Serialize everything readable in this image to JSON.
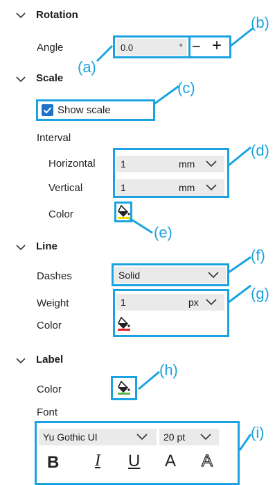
{
  "rotation": {
    "title": "Rotation",
    "angle_label": "Angle",
    "angle_value": "0.0",
    "angle_unit": "°",
    "minus": "−",
    "plus": "+"
  },
  "scale": {
    "title": "Scale",
    "show_scale_label": "Show scale",
    "show_scale_checked": true,
    "interval_label": "Interval",
    "horizontal_label": "Horizontal",
    "horizontal_value": "1",
    "horizontal_unit": "mm",
    "vertical_label": "Vertical",
    "vertical_value": "1",
    "vertical_unit": "mm",
    "color_label": "Color",
    "color_swatch": "#f0e000"
  },
  "line": {
    "title": "Line",
    "dashes_label": "Dashes",
    "dashes_value": "Solid",
    "weight_label": "Weight",
    "weight_value": "1",
    "weight_unit": "px",
    "color_label": "Color",
    "color_swatch": "#e0202a"
  },
  "label": {
    "title": "Label",
    "color_label": "Color",
    "color_swatch": "#55b84a",
    "font_label": "Font",
    "font_family": "Yu Gothic UI",
    "font_size": "20 pt",
    "bold": "B",
    "italic": "I",
    "underline": "U",
    "normal_a": "A",
    "outline_a": "A"
  },
  "callouts": {
    "a": "(a)",
    "b": "(b)",
    "c": "(c)",
    "d": "(d)",
    "e": "(e)",
    "f": "(f)",
    "g": "(g)",
    "h": "(h)",
    "i": "(i)"
  },
  "colors": {
    "accent": "#1aa3e0",
    "field_bg": "#eaeaea",
    "checkbox": "#1e73c8"
  },
  "icons": {
    "collapse": "chevron-down-icon",
    "paint": "paint-bucket-icon"
  }
}
